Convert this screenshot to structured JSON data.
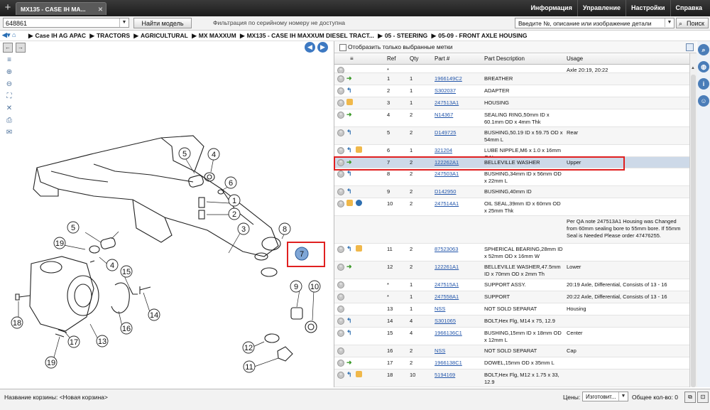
{
  "tab": {
    "title": "MX135 - CASE IH MA...",
    "close": "✕"
  },
  "top_menu": [
    "Информация",
    "Управление",
    "Настройки",
    "Справка"
  ],
  "toolbar": {
    "serial_value": "648861",
    "find_model_label": "Найти модель",
    "filter_notice": "Фильтрация по серийному номеру не доступна",
    "search_placeholder": "Введите №, описание или изображение детали",
    "search_button": "Поиск"
  },
  "breadcrumb": [
    "Case IH AG APAC",
    "TRACTORS",
    "AGRICULTURAL",
    "MX MAXXUM",
    "MX135 - CASE IH MAXXUM DIESEL TRACT...",
    "05 - STEERING",
    "05-09 - FRONT AXLE HOUSING"
  ],
  "parts_panel": {
    "filter_label": "Отобразить только выбранные метки",
    "columns": [
      "Ref",
      "Qty",
      "Part #",
      "Part Description",
      "Usage"
    ],
    "rows": [
      {
        "ref": "*",
        "qty": "",
        "part": "",
        "desc": "",
        "usage": "Axle 20:19, 20:22",
        "icons": []
      },
      {
        "ref": "1",
        "qty": "1",
        "part": "1966149C2",
        "desc": "BREATHER",
        "usage": "",
        "icons": [
          "arrow-green"
        ]
      },
      {
        "ref": "2",
        "qty": "1",
        "part": "S302037",
        "desc": "ADAPTER",
        "usage": "",
        "icons": [
          "arrow-blue"
        ]
      },
      {
        "ref": "3",
        "qty": "1",
        "part": "247513A1",
        "desc": "HOUSING",
        "usage": "",
        "icons": [
          "box"
        ]
      },
      {
        "ref": "4",
        "qty": "2",
        "part": "N14367",
        "desc": "SEALING RING,50mm ID x 60.1mm OD x 4mm Thk",
        "usage": "",
        "icons": [
          "arrow-green"
        ]
      },
      {
        "ref": "5",
        "qty": "2",
        "part": "D149725",
        "desc": "BUSHING,50.19 ID x 59.75 OD x 54mm L",
        "usage": "Rear",
        "icons": [
          "arrow-blue"
        ]
      },
      {
        "ref": "6",
        "qty": "1",
        "part": "321204",
        "desc": "LUBE NIPPLE,M6 x 1.0 x 16mm OAL",
        "usage": "",
        "icons": [
          "arrow-blue",
          "box"
        ]
      },
      {
        "ref": "7",
        "qty": "2",
        "part": "122262A1",
        "desc": "BELLEVILLE WASHER",
        "usage": "Upper",
        "icons": [
          "arrow-green"
        ]
      },
      {
        "ref": "8",
        "qty": "2",
        "part": "247503A1",
        "desc": "BUSHING,34mm ID x 56mm OD x 22mm L",
        "usage": "",
        "icons": [
          "arrow-blue"
        ]
      },
      {
        "ref": "9",
        "qty": "2",
        "part": "D142950",
        "desc": "BUSHING,40mm ID",
        "usage": "",
        "icons": [
          "arrow-blue"
        ]
      },
      {
        "ref": "10",
        "qty": "2",
        "part": "247514A1",
        "desc": "OIL SEAL,39mm ID x 60mm OD x 25mm Thk",
        "usage": "",
        "icons": [
          "box",
          "globe"
        ]
      },
      {
        "ref": "",
        "qty": "",
        "part": "",
        "desc": "",
        "usage": "Per QA note 247513A1 Housing was Changed from 60mm sealing bore to 55mm bore.  If 55mm Seal is Needed Please order 47476255.",
        "icons": []
      },
      {
        "ref": "11",
        "qty": "2",
        "part": "87523063",
        "desc": "SPHERICAL BEARING,28mm ID x 52mm OD x 16mm W",
        "usage": "",
        "icons": [
          "arrow-blue",
          "box"
        ]
      },
      {
        "ref": "12",
        "qty": "2",
        "part": "122261A1",
        "desc": "BELLEVILLE WASHER,47.5mm ID x 70mm OD x 2mm Th",
        "usage": "Lower",
        "icons": [
          "arrow-green"
        ]
      },
      {
        "ref": "*",
        "qty": "1",
        "part": "247515A1",
        "desc": "SUPPORT ASSY.",
        "usage": "20:19 Axle, Differential, Consists of 13 - 16",
        "icons": []
      },
      {
        "ref": "*",
        "qty": "1",
        "part": "247558A1",
        "desc": "SUPPORT",
        "usage": "20:22 Axle, Differential, Consists of 13 - 16",
        "icons": []
      },
      {
        "ref": "13",
        "qty": "1",
        "part": "NSS",
        "desc": "NOT SOLD SEPARAT",
        "usage": "Housing",
        "icons": []
      },
      {
        "ref": "14",
        "qty": "4",
        "part": "S301065",
        "desc": "BOLT,Hex Flg, M14 x 75, 12.9",
        "usage": "",
        "icons": [
          "arrow-blue"
        ]
      },
      {
        "ref": "15",
        "qty": "4",
        "part": "1966136C1",
        "desc": "BUSHING,15mm ID x 18mm OD x 12mm L",
        "usage": "Center",
        "icons": [
          "arrow-blue"
        ]
      },
      {
        "ref": "16",
        "qty": "2",
        "part": "NSS",
        "desc": "NOT SOLD SEPARAT",
        "usage": "Cap",
        "icons": []
      },
      {
        "ref": "17",
        "qty": "2",
        "part": "1966138C1",
        "desc": "DOWEL,15mm OD  x 35mm L",
        "usage": "",
        "icons": [
          "arrow-green"
        ]
      },
      {
        "ref": "18",
        "qty": "10",
        "part": "5194169",
        "desc": "BOLT,Hex Flg, M12 x 1.75 x 33, 12.9",
        "usage": "",
        "icons": [
          "arrow-blue",
          "box"
        ]
      }
    ]
  },
  "diagram_labels": [
    "1",
    "2",
    "3",
    "4",
    "4",
    "5",
    "5",
    "6",
    "7",
    "8",
    "9",
    "10",
    "11",
    "12",
    "13",
    "14",
    "15",
    "16",
    "17",
    "18",
    "19",
    "19"
  ],
  "bottom": {
    "cart_label": "Название корзины:",
    "cart_value": "<Новая корзина>",
    "prices_label": "Цены:",
    "manufacturer": "Изготовит...",
    "total_label": "Общее кол-во: 0"
  },
  "colors": {
    "accent": "#3d79c2",
    "highlight_row": "#cdd9e8",
    "red_box": "#e02020",
    "link": "#2255aa"
  }
}
